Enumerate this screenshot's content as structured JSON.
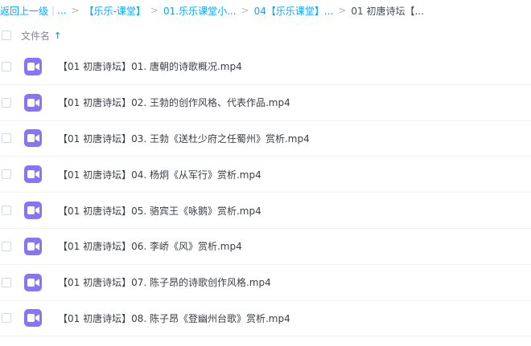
{
  "breadcrumb": {
    "back": "返回上一级",
    "ellipsis": "...",
    "items": [
      "【乐乐-课堂】",
      "01.乐乐课堂小...",
      "04【乐乐课堂】...",
      "01 初唐诗坛【..."
    ]
  },
  "header": {
    "column_label": "文件名",
    "sort_arrow": "↑"
  },
  "files": [
    {
      "name": "【01 初唐诗坛】01. 唐朝的诗歌概况.mp4"
    },
    {
      "name": "【01 初唐诗坛】02. 王勃的创作风格、代表作品.mp4"
    },
    {
      "name": "【01 初唐诗坛】03. 王勃《送杜少府之任蜀州》赏析.mp4"
    },
    {
      "name": "【01 初唐诗坛】04. 杨炯《从军行》赏析.mp4"
    },
    {
      "name": "【01 初唐诗坛】05. 骆宾王《咏鹅》赏析.mp4"
    },
    {
      "name": "【01 初唐诗坛】06. 李峤《风》赏析.mp4"
    },
    {
      "name": "【01 初唐诗坛】07. 陈子昂的诗歌创作风格.mp4"
    },
    {
      "name": "【01 初唐诗坛】08. 陈子昂《登幽州台歌》赏析.mp4"
    }
  ],
  "colors": {
    "link": "#06a7ff",
    "video_icon": "#8a74f6"
  }
}
